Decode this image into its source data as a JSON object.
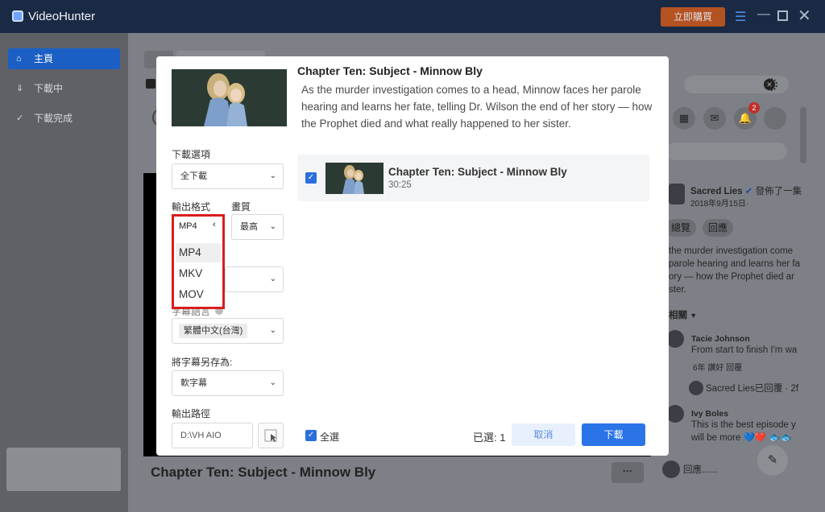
{
  "app": {
    "name": "VideoHunter",
    "buy_label": "立即購買"
  },
  "sidebar": {
    "items": [
      {
        "label": "主頁",
        "icon": "home-icon",
        "active": true
      },
      {
        "label": "下載中",
        "icon": "download-icon",
        "active": false
      },
      {
        "label": "下載完成",
        "icon": "check-circle-icon",
        "active": false
      }
    ]
  },
  "background": {
    "video_title": "Chapter Ten: Subject - Minnow Bly",
    "fb": {
      "page_name": "Sacred Lies",
      "post_meta": "2018年9月15日·",
      "post_action": "發佈了一集",
      "btn_view": "總覽",
      "btn_reply": "回應",
      "post_text": [
        "the murder investigation come",
        "parole hearing and learns her fat",
        "ory — how the Prophet died ar",
        "ster."
      ],
      "related_label": "相關",
      "comment1_author": "Tacie Johnson",
      "comment1_text": "From start to finish I'm wa",
      "comment1_meta": "6年   讚好   回覆",
      "reply_text": "Sacred Lies已回覆 · 2f",
      "comment2_author": "Ivy Boles",
      "comment2_text": "This is the best episode y",
      "comment2_text2": "will be more 💙❤️ 🐟🐟",
      "reply_placeholder": "回應......",
      "notif_count": "2"
    }
  },
  "modal": {
    "title": "Chapter Ten: Subject - Minnow Bly",
    "description": "As the murder investigation comes to a head, Minnow faces her parole hearing and learns her fate, telling Dr. Wilson the end of her story — how the Prophet died and what really happened to her sister.",
    "download_option_label": "下載選項",
    "download_option_value": "全下載",
    "output_format_label": "輸出格式",
    "quality_label": "畫質",
    "quality_value": "最高",
    "format_current": "MP4",
    "format_options": [
      "MP4",
      "MKV",
      "MOV"
    ],
    "subtitle_lang_label": "字幕語言",
    "subtitle_lang_value": "繁體中文(台灣)",
    "save_subtitle_label": "將字幕另存為:",
    "save_subtitle_value": "軟字幕",
    "output_path_label": "輸出路徑",
    "output_path_value": "D:\\VH AIO",
    "episode": {
      "title": "Chapter Ten: Subject - Minnow Bly",
      "duration": "30:25"
    },
    "select_all_label": "全選",
    "selected_count": "已選: 1",
    "cancel_label": "取消",
    "download_label": "下載"
  },
  "colors": {
    "accent": "#2a74e8",
    "highlight_border": "#d81e1e",
    "titlebar": "#1a2a45"
  }
}
